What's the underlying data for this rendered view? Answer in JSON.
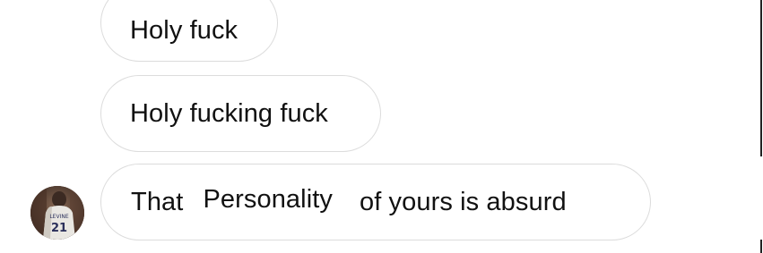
{
  "messages": [
    {
      "text": "Holy fuck"
    },
    {
      "text": "Holy fucking fuck"
    },
    {
      "prefix": "That",
      "overlay_text": "Personality",
      "suffix": "of yours is absurd"
    }
  ],
  "avatar": {
    "jersey_number": "21",
    "jersey_text": "LEVINE"
  },
  "colors": {
    "bubble_border": "#dcdcdc",
    "text": "#111111",
    "background": "#ffffff"
  }
}
